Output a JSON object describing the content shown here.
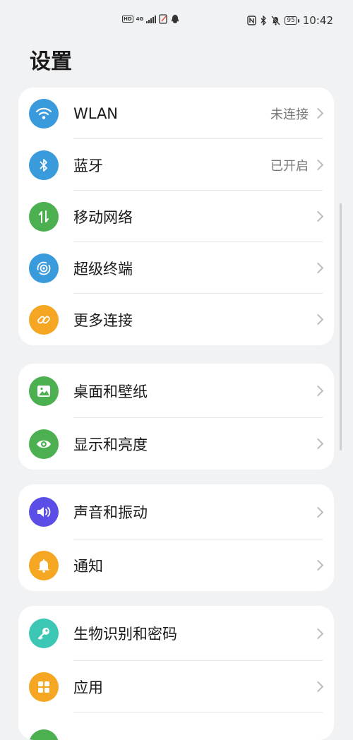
{
  "status_bar": {
    "hd_label": "HD",
    "network_label": "4G",
    "battery_level": "95",
    "time": "10:42"
  },
  "page": {
    "title": "设置"
  },
  "groups": [
    {
      "items": [
        {
          "label": "WLAN",
          "value": "未连接",
          "icon": "wifi-icon",
          "color": "#3a9bdc"
        },
        {
          "label": "蓝牙",
          "value": "已开启",
          "icon": "bluetooth-icon",
          "color": "#3a9bdc"
        },
        {
          "label": "移动网络",
          "value": "",
          "icon": "mobile-data-icon",
          "color": "#4caf50"
        },
        {
          "label": "超级终端",
          "value": "",
          "icon": "super-device-icon",
          "color": "#3a9bdc"
        },
        {
          "label": "更多连接",
          "value": "",
          "icon": "link-icon",
          "color": "#f5a623"
        }
      ]
    },
    {
      "items": [
        {
          "label": "桌面和壁纸",
          "value": "",
          "icon": "wallpaper-icon",
          "color": "#4caf50"
        },
        {
          "label": "显示和亮度",
          "value": "",
          "icon": "eye-icon",
          "color": "#4caf50"
        }
      ]
    },
    {
      "items": [
        {
          "label": "声音和振动",
          "value": "",
          "icon": "speaker-icon",
          "color": "#5b4ee6"
        },
        {
          "label": "通知",
          "value": "",
          "icon": "bell-icon",
          "color": "#f5a623"
        }
      ]
    },
    {
      "items": [
        {
          "label": "生物识别和密码",
          "value": "",
          "icon": "key-icon",
          "color": "#3cc7b5"
        },
        {
          "label": "应用",
          "value": "",
          "icon": "apps-grid-icon",
          "color": "#f5a623"
        }
      ]
    }
  ]
}
